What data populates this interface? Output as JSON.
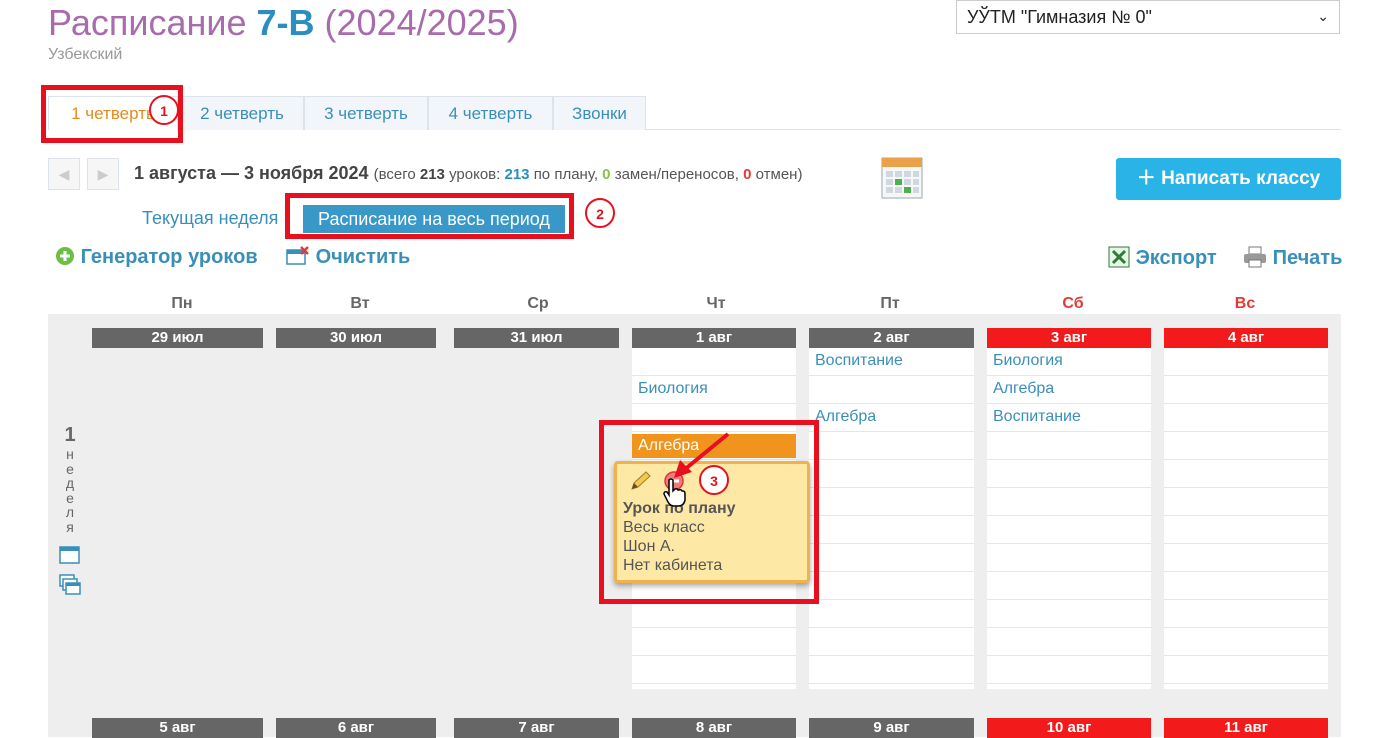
{
  "header": {
    "title_prefix": "Расписание",
    "class_name": "7-В",
    "year": "(2024/2025)",
    "subtitle": "Узбекский",
    "school_select": "УЎТМ \"Гимназия № 0\""
  },
  "tabs": [
    "1 четверть",
    "2 четверть",
    "3 четверть",
    "4 четверть",
    "Звонки"
  ],
  "period": {
    "range": "1 августа — 3 ноября 2024",
    "open": "(всего",
    "total": "213",
    "lessons_word": "уроков:",
    "planned": "213",
    "planned_word": "по плану,",
    "replacements": "0",
    "replacements_word": "замен/переносов,",
    "cancels": "0",
    "cancels_word": "отмен)"
  },
  "write_button": "Написать классу",
  "current_week": "Текущая неделя",
  "full_period": "Расписание на весь период",
  "toolbar": {
    "generator": "Генератор уроков",
    "clear": "Очистить",
    "export": "Экспорт",
    "print": "Печать"
  },
  "days": [
    "Пн",
    "Вт",
    "Ср",
    "Чт",
    "Пт",
    "Сб",
    "Вс"
  ],
  "week1_dates": [
    "29 июл",
    "30 июл",
    "31 июл",
    "1 авг",
    "2 авг",
    "3 авг",
    "4 авг"
  ],
  "week2_dates": [
    "5 авг",
    "6 авг",
    "7 авг",
    "8 авг",
    "9 авг",
    "10 авг",
    "11 авг"
  ],
  "week_label": {
    "num": "1",
    "word": "неделя"
  },
  "thu": {
    "row2": "Биология",
    "row4": "Алгебра"
  },
  "fri": {
    "row1": "Воспитание",
    "row3": "Алгебра"
  },
  "sat": {
    "row1": "Биология",
    "row2": "Алгебра",
    "row3": "Воспитание"
  },
  "popup": {
    "type": "Урок по плану",
    "group": "Весь класс",
    "teacher": "Шон А.",
    "room": "Нет кабинета"
  },
  "badges": [
    "1",
    "2",
    "3"
  ],
  "colors": {
    "accent": "#2a8fc0",
    "weekend": "#f21a1a",
    "highlight": "#e8101e",
    "lesson_orange": "#f0941e"
  }
}
